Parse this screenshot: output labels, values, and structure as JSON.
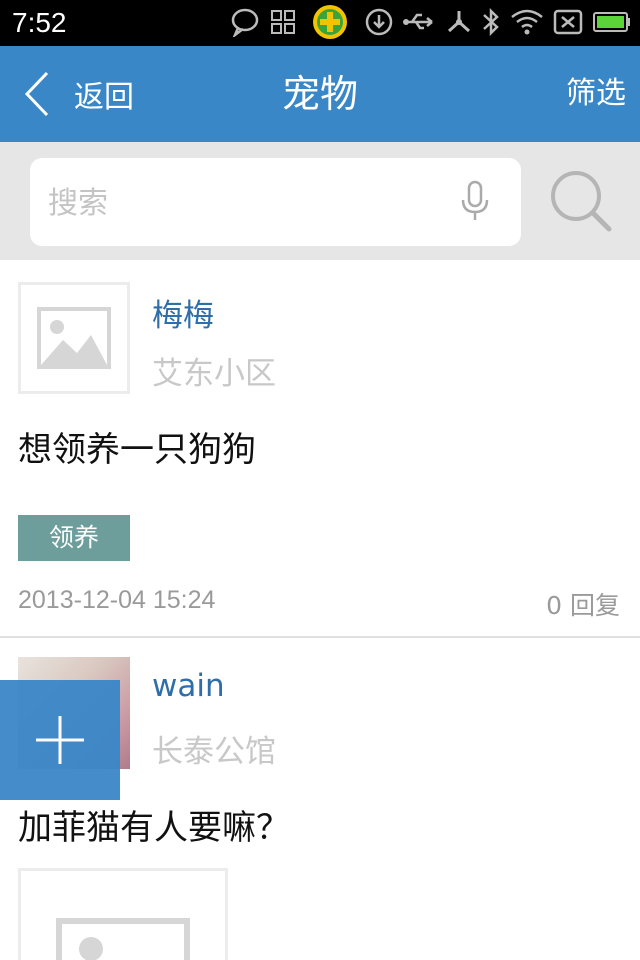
{
  "status_bar": {
    "time": "7:52",
    "icons": [
      "chat-bubble-icon",
      "grid-icon",
      "plus-badge-icon",
      "download-icon",
      "usb-icon",
      "share-icon",
      "bluetooth-icon",
      "wifi-icon",
      "no-sim-icon",
      "battery-icon"
    ]
  },
  "nav": {
    "back_label": "返回",
    "title": "宠物",
    "filter_label": "筛选"
  },
  "search": {
    "placeholder": "搜索"
  },
  "posts": [
    {
      "username": "梅梅",
      "location": "艾东小区",
      "text": "想领养一只狗狗",
      "tag": "领养",
      "date": "2013-12-04 15:24",
      "replies": "0 回复"
    },
    {
      "username": "wain",
      "location": "长泰公馆",
      "text": "加菲猫有人要嘛？"
    }
  ],
  "colors": {
    "accent": "#3a87c8",
    "tag": "#6d9e9b",
    "username": "#2f6ea8"
  }
}
